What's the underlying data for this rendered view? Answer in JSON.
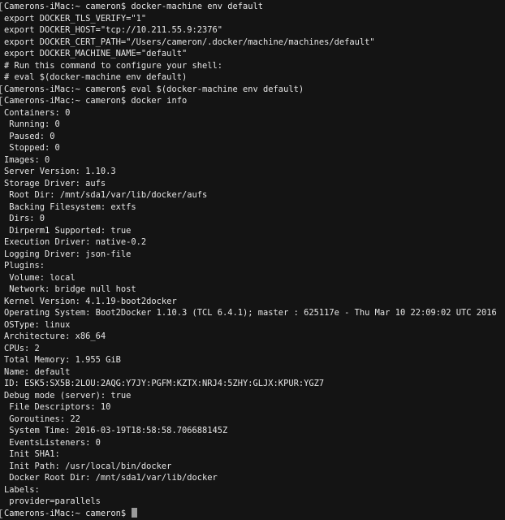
{
  "terminal": {
    "lines": [
      {
        "text": "Camerons-iMac:~ cameron$ docker-machine env default",
        "prompt": true
      },
      {
        "text": "export DOCKER_TLS_VERIFY=\"1\"",
        "prompt": false
      },
      {
        "text": "export DOCKER_HOST=\"tcp://10.211.55.9:2376\"",
        "prompt": false
      },
      {
        "text": "export DOCKER_CERT_PATH=\"/Users/cameron/.docker/machine/machines/default\"",
        "prompt": false
      },
      {
        "text": "export DOCKER_MACHINE_NAME=\"default\"",
        "prompt": false
      },
      {
        "text": "# Run this command to configure your shell:",
        "prompt": false
      },
      {
        "text": "# eval $(docker-machine env default)",
        "prompt": false
      },
      {
        "text": "Camerons-iMac:~ cameron$ eval $(docker-machine env default)",
        "prompt": true
      },
      {
        "text": "Camerons-iMac:~ cameron$ docker info",
        "prompt": true
      },
      {
        "text": "Containers: 0",
        "prompt": false
      },
      {
        "text": " Running: 0",
        "prompt": false
      },
      {
        "text": " Paused: 0",
        "prompt": false
      },
      {
        "text": " Stopped: 0",
        "prompt": false
      },
      {
        "text": "Images: 0",
        "prompt": false
      },
      {
        "text": "Server Version: 1.10.3",
        "prompt": false
      },
      {
        "text": "Storage Driver: aufs",
        "prompt": false
      },
      {
        "text": " Root Dir: /mnt/sda1/var/lib/docker/aufs",
        "prompt": false
      },
      {
        "text": " Backing Filesystem: extfs",
        "prompt": false
      },
      {
        "text": " Dirs: 0",
        "prompt": false
      },
      {
        "text": " Dirperm1 Supported: true",
        "prompt": false
      },
      {
        "text": "Execution Driver: native-0.2",
        "prompt": false
      },
      {
        "text": "Logging Driver: json-file",
        "prompt": false
      },
      {
        "text": "Plugins:",
        "prompt": false
      },
      {
        "text": " Volume: local",
        "prompt": false
      },
      {
        "text": " Network: bridge null host",
        "prompt": false
      },
      {
        "text": "Kernel Version: 4.1.19-boot2docker",
        "prompt": false
      },
      {
        "text": "Operating System: Boot2Docker 1.10.3 (TCL 6.4.1); master : 625117e - Thu Mar 10 22:09:02 UTC 2016",
        "prompt": false
      },
      {
        "text": "OSType: linux",
        "prompt": false
      },
      {
        "text": "Architecture: x86_64",
        "prompt": false
      },
      {
        "text": "CPUs: 2",
        "prompt": false
      },
      {
        "text": "Total Memory: 1.955 GiB",
        "prompt": false
      },
      {
        "text": "Name: default",
        "prompt": false
      },
      {
        "text": "ID: ESK5:SX5B:2LOU:2AQG:Y7JY:PGFM:KZTX:NRJ4:5ZHY:GLJX:KPUR:YGZ7",
        "prompt": false
      },
      {
        "text": "Debug mode (server): true",
        "prompt": false
      },
      {
        "text": " File Descriptors: 10",
        "prompt": false
      },
      {
        "text": " Goroutines: 22",
        "prompt": false
      },
      {
        "text": " System Time: 2016-03-19T18:58:58.706688145Z",
        "prompt": false
      },
      {
        "text": " EventsListeners: 0",
        "prompt": false
      },
      {
        "text": " Init SHA1:",
        "prompt": false
      },
      {
        "text": " Init Path: /usr/local/bin/docker",
        "prompt": false
      },
      {
        "text": " Docker Root Dir: /mnt/sda1/var/lib/docker",
        "prompt": false
      },
      {
        "text": "Labels:",
        "prompt": false
      },
      {
        "text": " provider=parallels",
        "prompt": false
      }
    ],
    "current_prompt": "Camerons-iMac:~ cameron$ ",
    "colors": {
      "background": "#141414",
      "foreground": "#e6e6e6",
      "cursor": "#9a9a9a"
    }
  }
}
